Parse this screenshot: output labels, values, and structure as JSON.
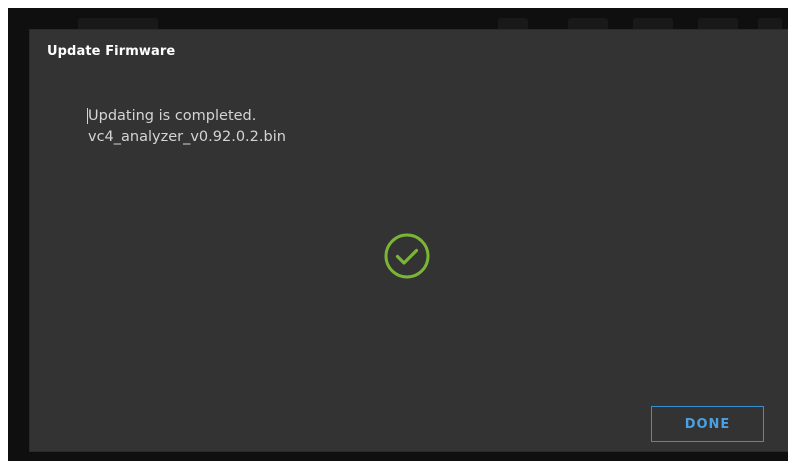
{
  "dialog": {
    "title": "Update Firmware",
    "message_line1": "Updating is completed.",
    "message_line2": "vc4_analyzer_v0.92.0.2.bin",
    "status_icon": "check-circle-icon",
    "done_label": "DONE"
  },
  "colors": {
    "dialog_background": "#333333",
    "success_accent": "#7bb535",
    "button_accent": "#3a8fcf"
  }
}
